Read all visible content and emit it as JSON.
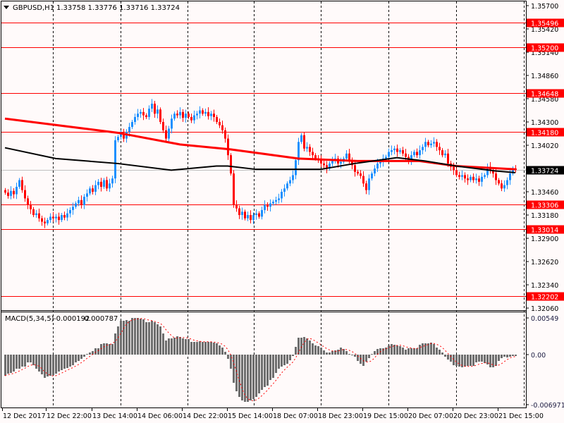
{
  "header": {
    "symbol": "GBPUSD,H1",
    "ohlc": "1.33758 1.33776 1.33716 1.33724"
  },
  "colors": {
    "background": "#FFFAFA",
    "bull": "#1E90FF",
    "bear": "#FF0000",
    "level_line": "#FF0000",
    "ma_slow": "#FF0000",
    "ma_fast": "#000000",
    "current_price_line": "#C0C0C0",
    "histogram": "#6E6E6E",
    "signal": "#FF0000"
  },
  "chart_data": {
    "type": "candlestick",
    "title": "GBPUSD,H1",
    "ylim": [
      1.32,
      1.3572
    ],
    "price_ticks": [
      "1.35700",
      "1.35420",
      "1.35140",
      "1.34860",
      "1.34580",
      "1.34300",
      "1.34020",
      "1.33460",
      "1.33180",
      "1.32900",
      "1.32620",
      "1.32340",
      "1.32060"
    ],
    "levels": [
      "1.35496",
      "1.35200",
      "1.34648",
      "1.34180",
      "1.33306",
      "1.33014",
      "1.32202"
    ],
    "current_price": "1.33724",
    "time_labels": [
      "12 Dec 2017",
      "12 Dec 22:00",
      "13 Dec 14:00",
      "14 Dec 06:00",
      "14 Dec 22:00",
      "15 Dec 14:00",
      "18 Dec 07:00",
      "18 Dec 23:00",
      "19 Dec 15:00",
      "20 Dec 07:00",
      "20 Dec 23:00",
      "21 Dec 15:00"
    ],
    "closes": [
      1.3345,
      1.3341,
      1.3347,
      1.3343,
      1.3352,
      1.336,
      1.3348,
      1.3338,
      1.333,
      1.3325,
      1.3318,
      1.332,
      1.3314,
      1.331,
      1.3308,
      1.3312,
      1.3316,
      1.3314,
      1.3316,
      1.3312,
      1.3318,
      1.3315,
      1.332,
      1.3324,
      1.3328,
      1.3332,
      1.3336,
      1.333,
      1.334,
      1.3344,
      1.335,
      1.3346,
      1.3354,
      1.3358,
      1.3352,
      1.336,
      1.335,
      1.3356,
      1.3362,
      1.3408,
      1.3412,
      1.3416,
      1.341,
      1.3418,
      1.3424,
      1.343,
      1.3436,
      1.344,
      1.3442,
      1.3438,
      1.3436,
      1.3446,
      1.3452,
      1.344,
      1.3445,
      1.343,
      1.342,
      1.341,
      1.3422,
      1.3434,
      1.344,
      1.3438,
      1.3442,
      1.3435,
      1.344,
      1.3436,
      1.3432,
      1.3438,
      1.344,
      1.3444,
      1.344,
      1.3442,
      1.3437,
      1.344,
      1.3436,
      1.343,
      1.3426,
      1.342,
      1.341,
      1.339,
      1.3368,
      1.333,
      1.3326,
      1.3318,
      1.3322,
      1.3314,
      1.3318,
      1.3312,
      1.3318,
      1.332,
      1.3316,
      1.3324,
      1.333,
      1.3328,
      1.3332,
      1.3334,
      1.3336,
      1.3338,
      1.3346,
      1.335,
      1.3356,
      1.336,
      1.3366,
      1.3384,
      1.3406,
      1.3414,
      1.3398,
      1.34,
      1.3394,
      1.339,
      1.3386,
      1.3384,
      1.338,
      1.3378,
      1.3374,
      1.338,
      1.3384,
      1.3386,
      1.338,
      1.3382,
      1.3386,
      1.3392,
      1.3384,
      1.3378,
      1.337,
      1.3368,
      1.3365,
      1.3356,
      1.3348,
      1.3362,
      1.3368,
      1.3374,
      1.338,
      1.3382,
      1.3386,
      1.3388,
      1.3394,
      1.3396,
      1.3398,
      1.3394,
      1.3396,
      1.3392,
      1.3388,
      1.3384,
      1.339,
      1.3394,
      1.339,
      1.3396,
      1.34,
      1.3406,
      1.3402,
      1.3404,
      1.3406,
      1.34,
      1.3396,
      1.339,
      1.3392,
      1.338,
      1.3376,
      1.3372,
      1.3366,
      1.3364,
      1.3366,
      1.3362,
      1.336,
      1.3364,
      1.336,
      1.3362,
      1.3358,
      1.3364,
      1.3366,
      1.3376,
      1.3372,
      1.3368,
      1.336,
      1.3356,
      1.335,
      1.3354,
      1.336,
      1.3368,
      1.3374,
      1.33724
    ],
    "ma_slow": [
      [
        0,
        1.3434
      ],
      [
        40,
        1.3417
      ],
      [
        62,
        1.3403
      ],
      [
        80,
        1.3397
      ],
      [
        104,
        1.3386
      ],
      [
        125,
        1.3383
      ],
      [
        147,
        1.3383
      ],
      [
        160,
        1.3377
      ],
      [
        181,
        1.3373
      ]
    ],
    "ma_fast": [
      [
        0,
        1.3399
      ],
      [
        18,
        1.3386
      ],
      [
        40,
        1.338
      ],
      [
        59,
        1.3372
      ],
      [
        75,
        1.3377
      ],
      [
        79,
        1.3377
      ],
      [
        89,
        1.3373
      ],
      [
        112,
        1.3373
      ],
      [
        124,
        1.338
      ],
      [
        139,
        1.3387
      ],
      [
        149,
        1.3383
      ],
      [
        160,
        1.3377
      ],
      [
        174,
        1.3371
      ],
      [
        181,
        1.3369
      ]
    ],
    "macd": {
      "title": "MACD(5,34,5)",
      "main_value": "-0.000192",
      "signal_value": "-0.000787",
      "ticks": [
        "0.00549",
        "0.00",
        "-0.006971"
      ],
      "ylim": [
        -0.006971,
        0.00549
      ],
      "histogram": [
        -0.003,
        -0.0027,
        -0.0026,
        -0.0024,
        -0.002,
        -0.002,
        -0.0017,
        -0.0017,
        -0.0011,
        -0.0011,
        -0.0015,
        -0.002,
        -0.0024,
        -0.0028,
        -0.0033,
        -0.0031,
        -0.003,
        -0.0029,
        -0.0027,
        -0.0024,
        -0.0022,
        -0.002,
        -0.0019,
        -0.0017,
        -0.0015,
        -0.0011,
        -0.0009,
        -0.0006,
        -0.0003,
        0.0001,
        0.0003,
        0.0005,
        0.0009,
        0.0009,
        0.0015,
        0.0016,
        0.0016,
        0.0015,
        0.0015,
        0.003,
        0.004,
        0.0048,
        0.0048,
        0.0049,
        0.0048,
        0.0052,
        0.0052,
        0.0052,
        0.0051,
        0.005,
        0.0046,
        0.0046,
        0.0048,
        0.0046,
        0.0043,
        0.004,
        0.003,
        0.002,
        0.0023,
        0.0023,
        0.0024,
        0.0026,
        0.0025,
        0.0023,
        0.0022,
        0.0022,
        0.0018,
        0.0018,
        0.0018,
        0.0019,
        0.0018,
        0.0018,
        0.0018,
        0.0018,
        0.0017,
        0.0016,
        0.0013,
        0.001,
        0.0004,
        -0.0006,
        -0.002,
        -0.004,
        -0.0052,
        -0.006,
        -0.0065,
        -0.0067,
        -0.0067,
        -0.0065,
        -0.0063,
        -0.006,
        -0.0055,
        -0.005,
        -0.0046,
        -0.0044,
        -0.0036,
        -0.0033,
        -0.0026,
        -0.002,
        -0.0017,
        -0.0015,
        -0.0013,
        -0.0008,
        -0.0002,
        0.0011,
        0.0024,
        0.0024,
        0.0025,
        0.0023,
        0.002,
        0.0016,
        0.0013,
        0.0012,
        0.001,
        0.0006,
        0.0003,
        0.0003,
        0.0005,
        0.0006,
        0.0007,
        0.001,
        0.0008,
        0.0005,
        0.0001,
        -0.0001,
        -0.0003,
        -0.0009,
        -0.0013,
        -0.0016,
        -0.001,
        -0.0005,
        0.0001,
        0.0005,
        0.0008,
        0.0009,
        0.0009,
        0.001,
        0.0013,
        0.0015,
        0.0014,
        0.0013,
        0.0012,
        0.001,
        0.0007,
        0.0009,
        0.0009,
        0.0009,
        0.0009,
        0.0014,
        0.0016,
        0.0016,
        0.0016,
        0.0017,
        0.0015,
        0.001,
        0.0007,
        0.0003,
        -0.0003,
        -0.0007,
        -0.001,
        -0.0015,
        -0.0016,
        -0.0017,
        -0.0018,
        -0.0017,
        -0.0016,
        -0.0016,
        -0.0016,
        -0.0011,
        -0.001,
        -0.001,
        -0.0012,
        -0.0014,
        -0.0018,
        -0.0018,
        -0.0016,
        -0.0009,
        -0.0005,
        -0.0003,
        -0.0004,
        -0.0003,
        -0.0002,
        -0.0002
      ]
    }
  }
}
